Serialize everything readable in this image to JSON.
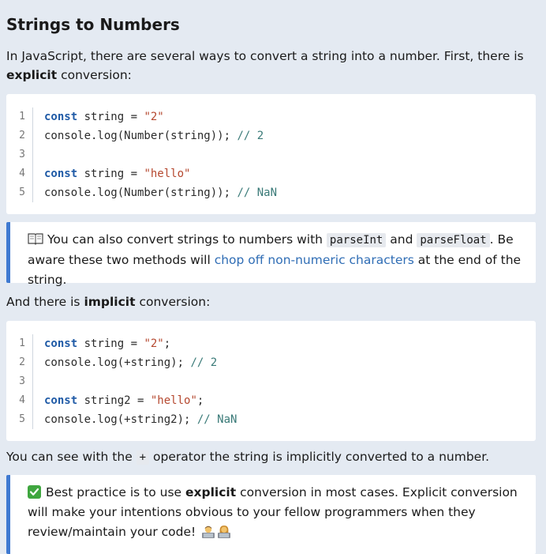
{
  "title": "Strings to Numbers",
  "intro": {
    "text": "In JavaScript, there are several ways to convert a string into a number. First, there is ",
    "bold": "explicit",
    "tail": " conversion:"
  },
  "code1": {
    "line_numbers": [
      "1",
      "2",
      "3",
      "4",
      "5"
    ],
    "lines": [
      [
        {
          "t": "const",
          "c": "kw"
        },
        {
          "t": " string = ",
          "c": ""
        },
        {
          "t": "\"2\"",
          "c": "str"
        }
      ],
      [
        {
          "t": "console.log(Number(string)); ",
          "c": ""
        },
        {
          "t": "// 2",
          "c": "cm"
        }
      ],
      [],
      [
        {
          "t": "const",
          "c": "kw"
        },
        {
          "t": " string = ",
          "c": ""
        },
        {
          "t": "\"hello\"",
          "c": "str"
        }
      ],
      [
        {
          "t": "console.log(Number(string)); ",
          "c": ""
        },
        {
          "t": "// NaN",
          "c": "cm"
        }
      ]
    ]
  },
  "callout1": {
    "icon": "book-icon",
    "t1": "You can also convert strings to numbers with ",
    "code_a": "parseInt",
    "t2": " and ",
    "code_b": "parseFloat",
    "t3": ". Be aware these two methods will ",
    "link": "chop off non-numeric characters",
    "t4": " at the end of the string."
  },
  "implicit_para": {
    "text": "And there is ",
    "bold": "implicit",
    "tail": " conversion:"
  },
  "code2": {
    "line_numbers": [
      "1",
      "2",
      "3",
      "4",
      "5"
    ],
    "lines": [
      [
        {
          "t": "const",
          "c": "kw"
        },
        {
          "t": " string = ",
          "c": ""
        },
        {
          "t": "\"2\"",
          "c": "str"
        },
        {
          "t": ";",
          "c": ""
        }
      ],
      [
        {
          "t": "console.log(+string); ",
          "c": ""
        },
        {
          "t": "// 2",
          "c": "cm"
        }
      ],
      [],
      [
        {
          "t": "const",
          "c": "kw"
        },
        {
          "t": " string2 = ",
          "c": ""
        },
        {
          "t": "\"hello\"",
          "c": "str"
        },
        {
          "t": ";",
          "c": ""
        }
      ],
      [
        {
          "t": "console.log(+string2); ",
          "c": ""
        },
        {
          "t": "// NaN",
          "c": "cm"
        }
      ]
    ]
  },
  "operator_para": {
    "t1": "You can see with the ",
    "code": "+",
    "t2": " operator the string is implicitly converted to a number."
  },
  "callout2": {
    "icon": "check-mark-icon",
    "t1": "Best practice is to use ",
    "bold": "explicit",
    "t2": " conversion in most cases. Explicit conversion will make your intentions obvious to your fellow programmers when they review/maintain your code! ",
    "emoji_icons": [
      "man-technologist-icon",
      "woman-technologist-icon"
    ]
  },
  "colors": {
    "background": "#e4eaf2",
    "keyword": "#1f5aa6",
    "string": "#b5482f",
    "comment": "#3a7a78",
    "callout_border": "#3f7ad1",
    "link": "#2f6db5",
    "check": "#3fa63f"
  }
}
